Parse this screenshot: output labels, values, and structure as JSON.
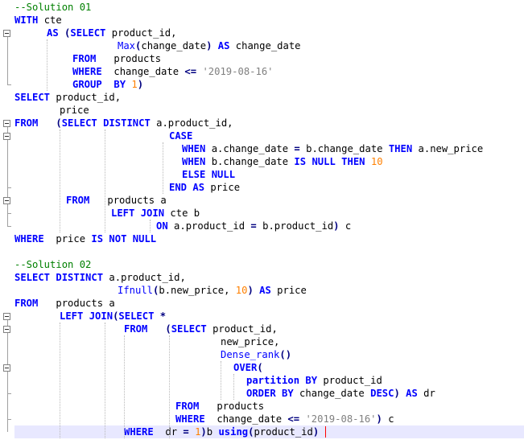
{
  "editor": {
    "lines": [
      {
        "indent": 0,
        "tokens": [
          {
            "t": "--Solution 01",
            "c": "cm"
          }
        ]
      },
      {
        "indent": 0,
        "tokens": [
          {
            "t": "WITH",
            "c": "kw"
          },
          {
            "t": " cte",
            "c": "id"
          }
        ]
      },
      {
        "indent": 40,
        "tokens": [
          {
            "t": "AS",
            "c": "kw"
          },
          {
            "t": " ",
            "c": "id"
          },
          {
            "t": "(",
            "c": "op"
          },
          {
            "t": "SELECT",
            "c": "kw"
          },
          {
            "t": " product_id,",
            "c": "id"
          }
        ]
      },
      {
        "indent": 128,
        "tokens": [
          {
            "t": "Max",
            "c": "fn"
          },
          {
            "t": "(",
            "c": "op"
          },
          {
            "t": "change_date",
            "c": "id"
          },
          {
            "t": ")",
            "c": "op"
          },
          {
            "t": " ",
            "c": "id"
          },
          {
            "t": "AS",
            "c": "kw"
          },
          {
            "t": " change_date",
            "c": "id"
          }
        ]
      },
      {
        "indent": 72,
        "tokens": [
          {
            "t": "FROM",
            "c": "kw"
          },
          {
            "t": "   products",
            "c": "id"
          }
        ]
      },
      {
        "indent": 72,
        "tokens": [
          {
            "t": "WHERE",
            "c": "kw"
          },
          {
            "t": "  change_date ",
            "c": "id"
          },
          {
            "t": "<=",
            "c": "op"
          },
          {
            "t": " ",
            "c": "id"
          },
          {
            "t": "'2019-08-16'",
            "c": "str"
          }
        ]
      },
      {
        "indent": 72,
        "tokens": [
          {
            "t": "GROUP",
            "c": "kw"
          },
          {
            "t": "  ",
            "c": "id"
          },
          {
            "t": "BY",
            "c": "kw"
          },
          {
            "t": " ",
            "c": "id"
          },
          {
            "t": "1",
            "c": "num"
          },
          {
            "t": ")",
            "c": "op"
          }
        ]
      },
      {
        "indent": 0,
        "tokens": [
          {
            "t": "SELECT",
            "c": "kw"
          },
          {
            "t": " product_id,",
            "c": "id"
          }
        ]
      },
      {
        "indent": 56,
        "tokens": [
          {
            "t": "price",
            "c": "id"
          }
        ]
      },
      {
        "indent": 0,
        "tokens": [
          {
            "t": "FROM",
            "c": "kw"
          },
          {
            "t": "   ",
            "c": "id"
          },
          {
            "t": "(",
            "c": "op"
          },
          {
            "t": "SELECT",
            "c": "kw"
          },
          {
            "t": " ",
            "c": "id"
          },
          {
            "t": "DISTINCT",
            "c": "kw"
          },
          {
            "t": " a.product_id,",
            "c": "id"
          }
        ]
      },
      {
        "indent": 192,
        "tokens": [
          {
            "t": "CASE",
            "c": "kw"
          }
        ]
      },
      {
        "indent": 208,
        "tokens": [
          {
            "t": "WHEN",
            "c": "kw"
          },
          {
            "t": " a.change_date ",
            "c": "id"
          },
          {
            "t": "=",
            "c": "op"
          },
          {
            "t": " b.change_date ",
            "c": "id"
          },
          {
            "t": "THEN",
            "c": "kw"
          },
          {
            "t": " a.new_price",
            "c": "id"
          }
        ]
      },
      {
        "indent": 208,
        "tokens": [
          {
            "t": "WHEN",
            "c": "kw"
          },
          {
            "t": " b.change_date ",
            "c": "id"
          },
          {
            "t": "IS",
            "c": "kw"
          },
          {
            "t": " ",
            "c": "id"
          },
          {
            "t": "NULL",
            "c": "kw"
          },
          {
            "t": " ",
            "c": "id"
          },
          {
            "t": "THEN",
            "c": "kw"
          },
          {
            "t": " ",
            "c": "id"
          },
          {
            "t": "10",
            "c": "num"
          }
        ]
      },
      {
        "indent": 208,
        "tokens": [
          {
            "t": "ELSE",
            "c": "kw"
          },
          {
            "t": " ",
            "c": "id"
          },
          {
            "t": "NULL",
            "c": "kw"
          }
        ]
      },
      {
        "indent": 192,
        "tokens": [
          {
            "t": "END",
            "c": "kw"
          },
          {
            "t": " ",
            "c": "id"
          },
          {
            "t": "AS",
            "c": "kw"
          },
          {
            "t": " price",
            "c": "id"
          }
        ]
      },
      {
        "indent": 64,
        "tokens": [
          {
            "t": "FROM",
            "c": "kw"
          },
          {
            "t": "   products a",
            "c": "id"
          }
        ]
      },
      {
        "indent": 120,
        "tokens": [
          {
            "t": "LEFT",
            "c": "kw"
          },
          {
            "t": " ",
            "c": "id"
          },
          {
            "t": "JOIN",
            "c": "kw"
          },
          {
            "t": " cte b",
            "c": "id"
          }
        ]
      },
      {
        "indent": 176,
        "tokens": [
          {
            "t": "ON",
            "c": "kw"
          },
          {
            "t": " a.product_id ",
            "c": "id"
          },
          {
            "t": "=",
            "c": "op"
          },
          {
            "t": " b.product_id",
            "c": "id"
          },
          {
            "t": ")",
            "c": "op"
          },
          {
            "t": " c",
            "c": "id"
          }
        ]
      },
      {
        "indent": 0,
        "tokens": [
          {
            "t": "WHERE",
            "c": "kw"
          },
          {
            "t": "  price ",
            "c": "id"
          },
          {
            "t": "IS",
            "c": "kw"
          },
          {
            "t": " ",
            "c": "id"
          },
          {
            "t": "NOT",
            "c": "kw"
          },
          {
            "t": " ",
            "c": "id"
          },
          {
            "t": "NULL",
            "c": "kw"
          }
        ]
      },
      {
        "indent": 0,
        "tokens": []
      },
      {
        "indent": 0,
        "tokens": [
          {
            "t": "--Solution 02",
            "c": "cm"
          }
        ]
      },
      {
        "indent": 0,
        "tokens": [
          {
            "t": "SELECT",
            "c": "kw"
          },
          {
            "t": " ",
            "c": "id"
          },
          {
            "t": "DISTINCT",
            "c": "kw"
          },
          {
            "t": " a.product_id,",
            "c": "id"
          }
        ]
      },
      {
        "indent": 128,
        "tokens": [
          {
            "t": "Ifnull",
            "c": "fn"
          },
          {
            "t": "(",
            "c": "op"
          },
          {
            "t": "b.new_price, ",
            "c": "id"
          },
          {
            "t": "10",
            "c": "num"
          },
          {
            "t": ")",
            "c": "op"
          },
          {
            "t": " ",
            "c": "id"
          },
          {
            "t": "AS",
            "c": "kw"
          },
          {
            "t": " price",
            "c": "id"
          }
        ]
      },
      {
        "indent": 0,
        "tokens": [
          {
            "t": "FROM",
            "c": "kw"
          },
          {
            "t": "   products a",
            "c": "id"
          }
        ]
      },
      {
        "indent": 56,
        "tokens": [
          {
            "t": "LEFT",
            "c": "kw"
          },
          {
            "t": " ",
            "c": "id"
          },
          {
            "t": "JOIN",
            "c": "kw"
          },
          {
            "t": "(",
            "c": "op"
          },
          {
            "t": "SELECT",
            "c": "kw"
          },
          {
            "t": " ",
            "c": "id"
          },
          {
            "t": "*",
            "c": "op"
          }
        ]
      },
      {
        "indent": 136,
        "tokens": [
          {
            "t": "FROM",
            "c": "kw"
          },
          {
            "t": "   ",
            "c": "id"
          },
          {
            "t": "(",
            "c": "op"
          },
          {
            "t": "SELECT",
            "c": "kw"
          },
          {
            "t": " product_id,",
            "c": "id"
          }
        ]
      },
      {
        "indent": 256,
        "tokens": [
          {
            "t": "new_price,",
            "c": "id"
          }
        ]
      },
      {
        "indent": 256,
        "tokens": [
          {
            "t": "Dense_rank",
            "c": "fn"
          },
          {
            "t": "()",
            "c": "op"
          }
        ]
      },
      {
        "indent": 272,
        "tokens": [
          {
            "t": "OVER",
            "c": "kw"
          },
          {
            "t": "(",
            "c": "op"
          }
        ]
      },
      {
        "indent": 288,
        "tokens": [
          {
            "t": "partition",
            "c": "kw"
          },
          {
            "t": " ",
            "c": "id"
          },
          {
            "t": "BY",
            "c": "kw"
          },
          {
            "t": " product_id",
            "c": "id"
          }
        ]
      },
      {
        "indent": 288,
        "tokens": [
          {
            "t": "ORDER",
            "c": "kw"
          },
          {
            "t": " ",
            "c": "id"
          },
          {
            "t": "BY",
            "c": "kw"
          },
          {
            "t": " change_date ",
            "c": "id"
          },
          {
            "t": "DESC",
            "c": "kw"
          },
          {
            "t": ")",
            "c": "op"
          },
          {
            "t": " ",
            "c": "id"
          },
          {
            "t": "AS",
            "c": "kw"
          },
          {
            "t": " dr",
            "c": "id"
          }
        ]
      },
      {
        "indent": 200,
        "tokens": [
          {
            "t": "FROM",
            "c": "kw"
          },
          {
            "t": "   products",
            "c": "id"
          }
        ]
      },
      {
        "indent": 200,
        "tokens": [
          {
            "t": "WHERE",
            "c": "kw"
          },
          {
            "t": "  change_date ",
            "c": "id"
          },
          {
            "t": "<=",
            "c": "op"
          },
          {
            "t": " ",
            "c": "id"
          },
          {
            "t": "'2019-08-16'",
            "c": "str"
          },
          {
            "t": ")",
            "c": "op"
          },
          {
            "t": " c",
            "c": "id"
          }
        ]
      },
      {
        "indent": 136,
        "current": true,
        "tokens": [
          {
            "t": "WHERE",
            "c": "kw"
          },
          {
            "t": "  dr ",
            "c": "id"
          },
          {
            "t": "=",
            "c": "op"
          },
          {
            "t": " ",
            "c": "id"
          },
          {
            "t": "1",
            "c": "num"
          },
          {
            "t": ")",
            "c": "op"
          },
          {
            "t": "b ",
            "c": "id"
          },
          {
            "t": "using",
            "c": "kw"
          },
          {
            "t": "(",
            "c": "op"
          },
          {
            "t": "product_id",
            "c": "id"
          },
          {
            "t": ")",
            "c": "op"
          }
        ]
      }
    ],
    "colors": {
      "keyword": "#0000ff",
      "comment": "#008000",
      "string": "#808080",
      "number": "#ff8000",
      "operator": "#000080",
      "current_line": "#e8e8ff",
      "caret": "#ff0000"
    },
    "fold_icons": [
      "fold-minus-icon"
    ]
  }
}
